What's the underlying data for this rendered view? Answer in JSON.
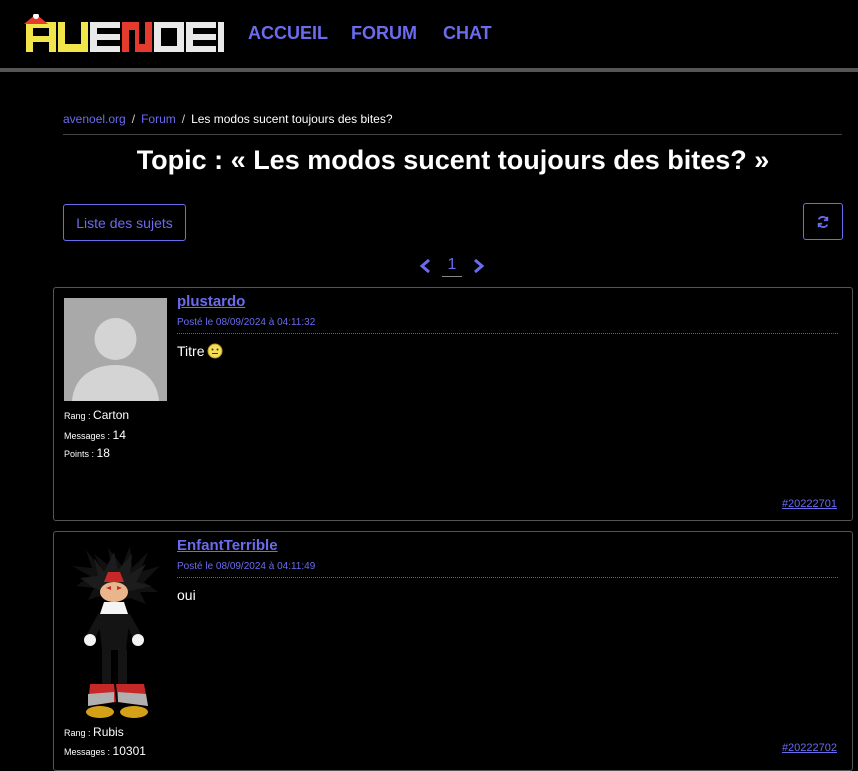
{
  "header": {
    "logo_text": "AVENOEL",
    "nav": [
      "ACCUEIL",
      "FORUM",
      "CHAT"
    ]
  },
  "breadcrumb": {
    "items": [
      "avenoel.org",
      "Forum"
    ],
    "current": "Les modos sucent toujours des bites?"
  },
  "page_title": "Topic : « Les modos sucent toujours des bites? »",
  "toolbar": {
    "subjects_button": "Liste des sujets",
    "refresh_icon": "refresh-icon"
  },
  "pagination": {
    "current": "1",
    "prev_icon": "chevron-left-icon",
    "next_icon": "chevron-right-icon"
  },
  "posts": [
    {
      "author": "plustardo",
      "date": "Posté le 08/09/2024 à 04:11:32",
      "content": "Titre",
      "emoji": "smiley-icon",
      "rank_label": "Rang",
      "rank": "Carton",
      "messages_label": "Messages",
      "messages": "14",
      "points_label": "Points",
      "points": "18",
      "id": "#20222701"
    },
    {
      "author": "EnfantTerrible",
      "date": "Posté le 08/09/2024 à 04:11:49",
      "content": "oui",
      "rank_label": "Rang",
      "rank": "Rubis",
      "messages_label": "Messages",
      "messages": "10301",
      "id": "#20222702"
    }
  ],
  "colors": {
    "accent": "#6b6bee",
    "background": "#000000",
    "border": "#555555"
  }
}
